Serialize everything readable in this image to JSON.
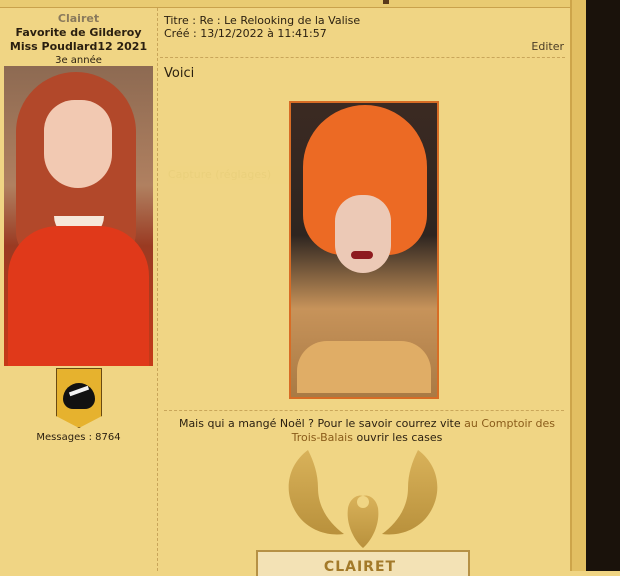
{
  "profile": {
    "username": "Clairet",
    "rank_line_1": "Favorite de Gilderoy",
    "rank_line_2": "Miss Poudlard12 2021",
    "year": "3e année",
    "messages": "Messages : 8764"
  },
  "post": {
    "title": "Titre : Re : Le Relooking de la Valise",
    "created": "Créé : 13/12/2022 à 11:41:57",
    "edit_label": "Editer",
    "body_text": "Voici",
    "faint_caption": "Capture (réglages)"
  },
  "signature": {
    "text_before": "Mais qui a mangé Noël ? Pour le savoir courrez vite ",
    "link_label": "au Comptoir des Trois-Balais",
    "text_after": " ouvrir les cases",
    "plaque_text": "CLAIRET"
  },
  "colors": {
    "background": "#f0d584",
    "accent_orange": "#d76c25",
    "link": "#8a5c1a"
  }
}
